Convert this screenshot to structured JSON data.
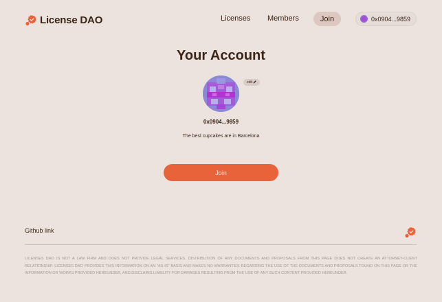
{
  "brand": {
    "name": "License DAO",
    "logo_icon": "badge-check-icon",
    "accent": "#e9633a"
  },
  "nav": {
    "links": [
      "Licenses",
      "Members"
    ],
    "join_label": "Join",
    "wallet_address": "0x0904...9859"
  },
  "account": {
    "title": "Your Account",
    "edit_label": "edit",
    "address": "0x0904...9859",
    "bio": "The best cupcakes are in Barcelona",
    "join_label": "Join"
  },
  "footer": {
    "github_label": "Github link",
    "disclaimer": "Licenses DAO is not a law firm and does not provide legal services. Distribution of any documents and proposals from this page does not create an attorney-client relationship. Licenses DAO provides this information on an \"as-is\" basis and makes no warranties regarding the use of the documents and proposals found on this page or the information or works provided hereunder, and disclaims liability for damages resulting from the use of any such content provided hereunder."
  }
}
